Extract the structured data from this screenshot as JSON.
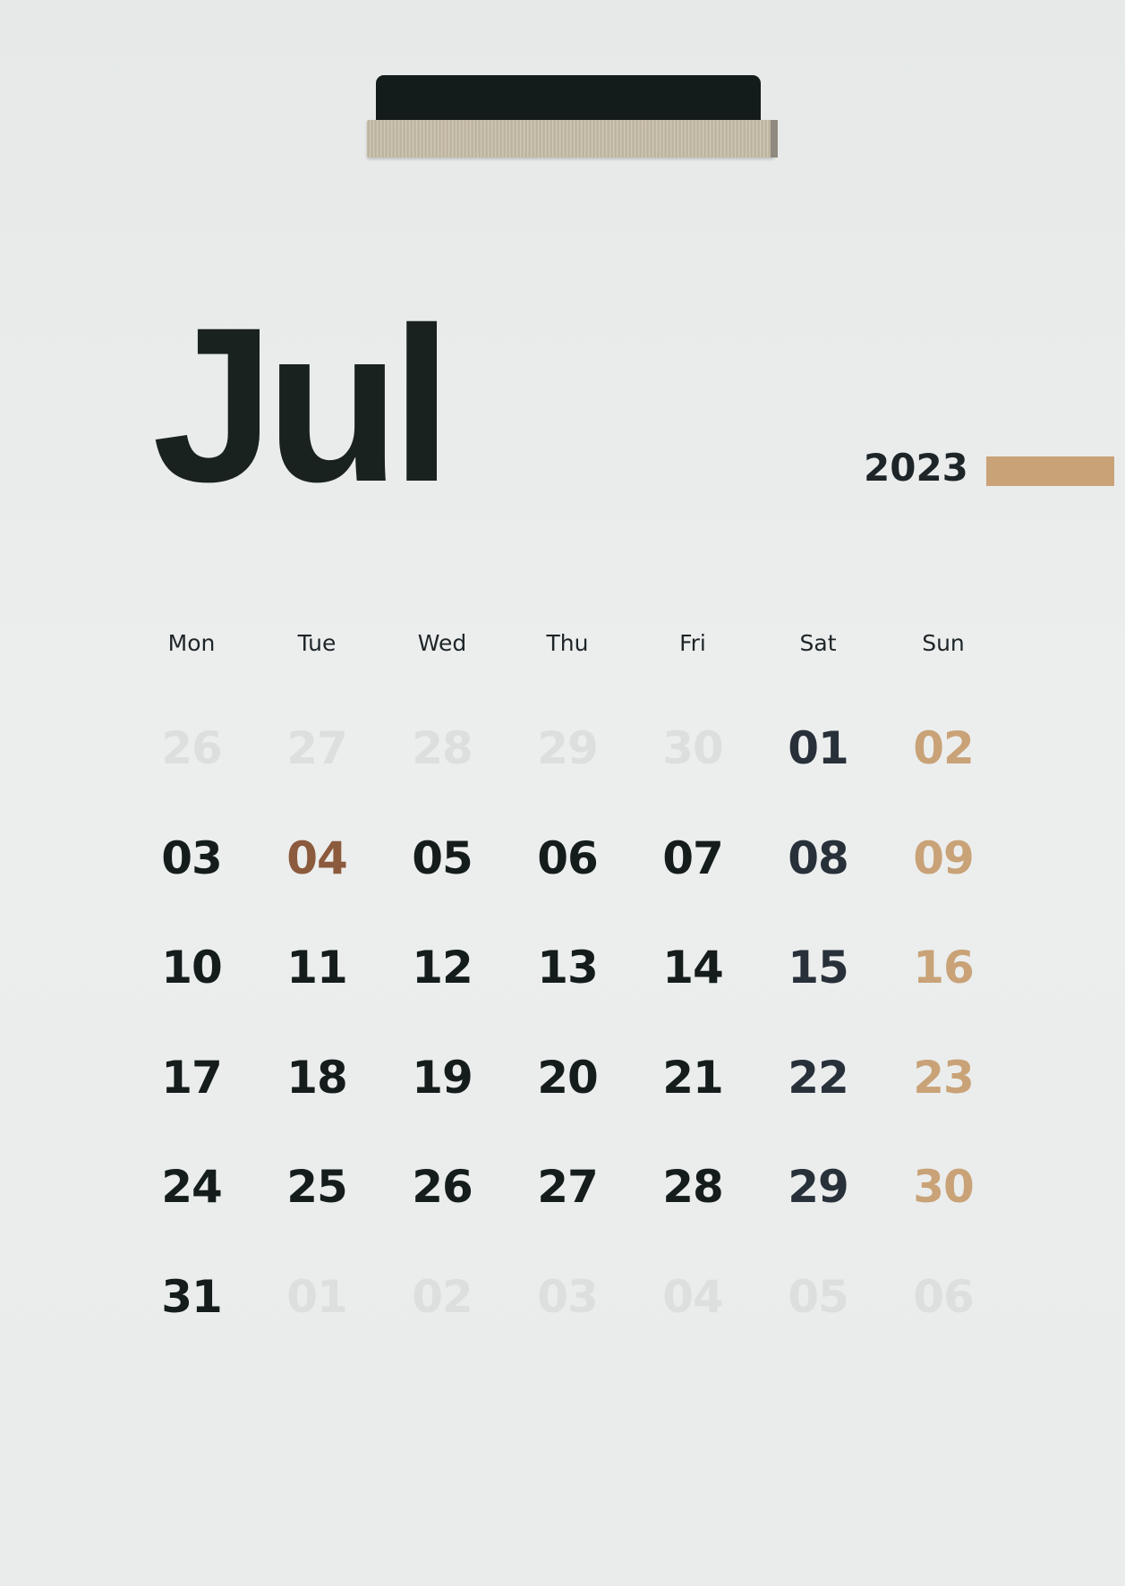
{
  "calendar": {
    "month": "Jul",
    "year": "2023",
    "accent_color": "#c9a277",
    "holiday_color": "#8c5a3c",
    "weekdays": [
      "Mon",
      "Tue",
      "Wed",
      "Thu",
      "Fri",
      "Sat",
      "Sun"
    ],
    "weeks": [
      [
        {
          "d": "26",
          "t": "outside"
        },
        {
          "d": "27",
          "t": "outside"
        },
        {
          "d": "28",
          "t": "outside"
        },
        {
          "d": "29",
          "t": "outside"
        },
        {
          "d": "30",
          "t": "outside"
        },
        {
          "d": "01",
          "t": "sat"
        },
        {
          "d": "02",
          "t": "sunday"
        }
      ],
      [
        {
          "d": "03",
          "t": "normal"
        },
        {
          "d": "04",
          "t": "holiday"
        },
        {
          "d": "05",
          "t": "normal"
        },
        {
          "d": "06",
          "t": "normal"
        },
        {
          "d": "07",
          "t": "normal"
        },
        {
          "d": "08",
          "t": "sat"
        },
        {
          "d": "09",
          "t": "sunday"
        }
      ],
      [
        {
          "d": "10",
          "t": "normal"
        },
        {
          "d": "11",
          "t": "normal"
        },
        {
          "d": "12",
          "t": "normal"
        },
        {
          "d": "13",
          "t": "normal"
        },
        {
          "d": "14",
          "t": "normal"
        },
        {
          "d": "15",
          "t": "sat"
        },
        {
          "d": "16",
          "t": "sunday"
        }
      ],
      [
        {
          "d": "17",
          "t": "normal"
        },
        {
          "d": "18",
          "t": "normal"
        },
        {
          "d": "19",
          "t": "normal"
        },
        {
          "d": "20",
          "t": "normal"
        },
        {
          "d": "21",
          "t": "normal"
        },
        {
          "d": "22",
          "t": "sat"
        },
        {
          "d": "23",
          "t": "sunday"
        }
      ],
      [
        {
          "d": "24",
          "t": "normal"
        },
        {
          "d": "25",
          "t": "normal"
        },
        {
          "d": "26",
          "t": "normal"
        },
        {
          "d": "27",
          "t": "normal"
        },
        {
          "d": "28",
          "t": "normal"
        },
        {
          "d": "29",
          "t": "sat"
        },
        {
          "d": "30",
          "t": "sunday"
        }
      ],
      [
        {
          "d": "31",
          "t": "normal"
        },
        {
          "d": "01",
          "t": "outside"
        },
        {
          "d": "02",
          "t": "outside"
        },
        {
          "d": "03",
          "t": "outside"
        },
        {
          "d": "04",
          "t": "outside"
        },
        {
          "d": "05",
          "t": "outside"
        },
        {
          "d": "06",
          "t": "outside"
        }
      ]
    ]
  }
}
